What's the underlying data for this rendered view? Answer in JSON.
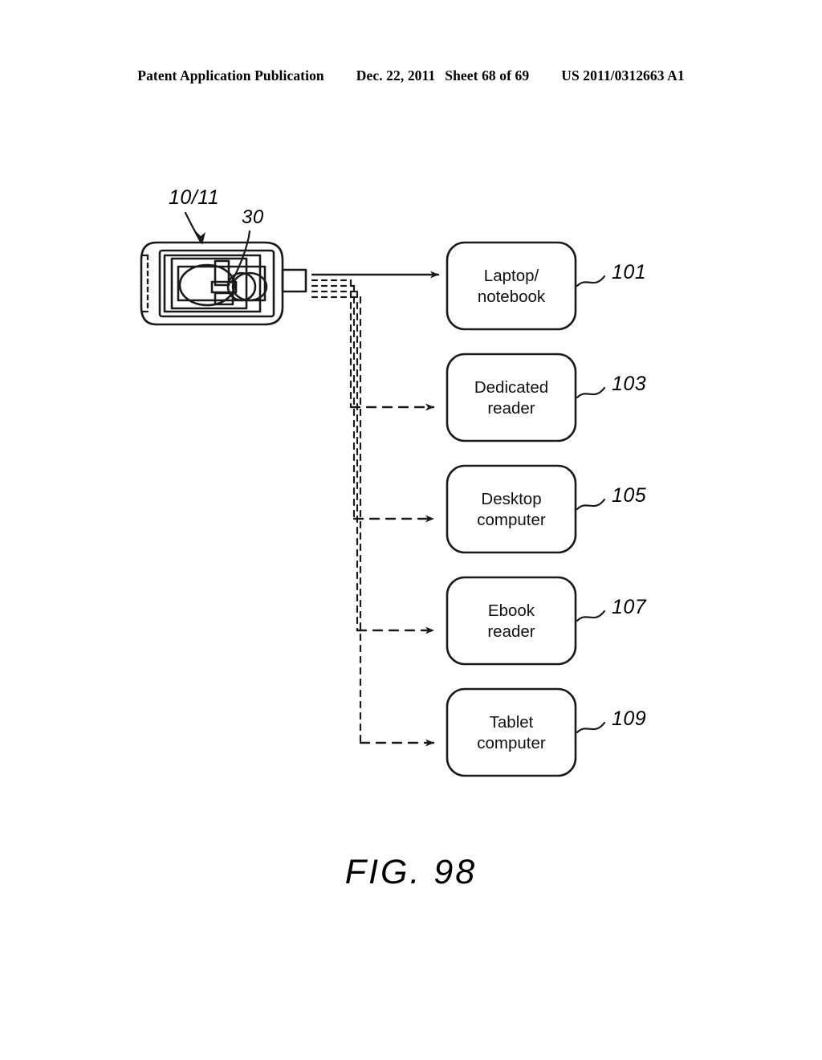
{
  "header": {
    "publication": "Patent Application Publication",
    "date": "Dec. 22, 2011",
    "sheet": "Sheet 68 of 69",
    "patent_number": "US 2011/0312663 A1"
  },
  "figure": {
    "caption": "FIG. 98",
    "device": {
      "ref_label": "10/11",
      "inner_component_ref": "30"
    },
    "targets": [
      {
        "label": "Laptop/\nnotebook",
        "ref": "101",
        "connector": "solid"
      },
      {
        "label": "Dedicated\nreader",
        "ref": "103",
        "connector": "dashed"
      },
      {
        "label": "Desktop\ncomputer",
        "ref": "105",
        "connector": "dashed"
      },
      {
        "label": "Ebook\nreader",
        "ref": "107",
        "connector": "dashed"
      },
      {
        "label": "Tablet\ncomputer",
        "ref": "109",
        "connector": "dashed"
      }
    ]
  },
  "colors": {
    "ink": "#1a1a1a",
    "paper": "#ffffff"
  }
}
